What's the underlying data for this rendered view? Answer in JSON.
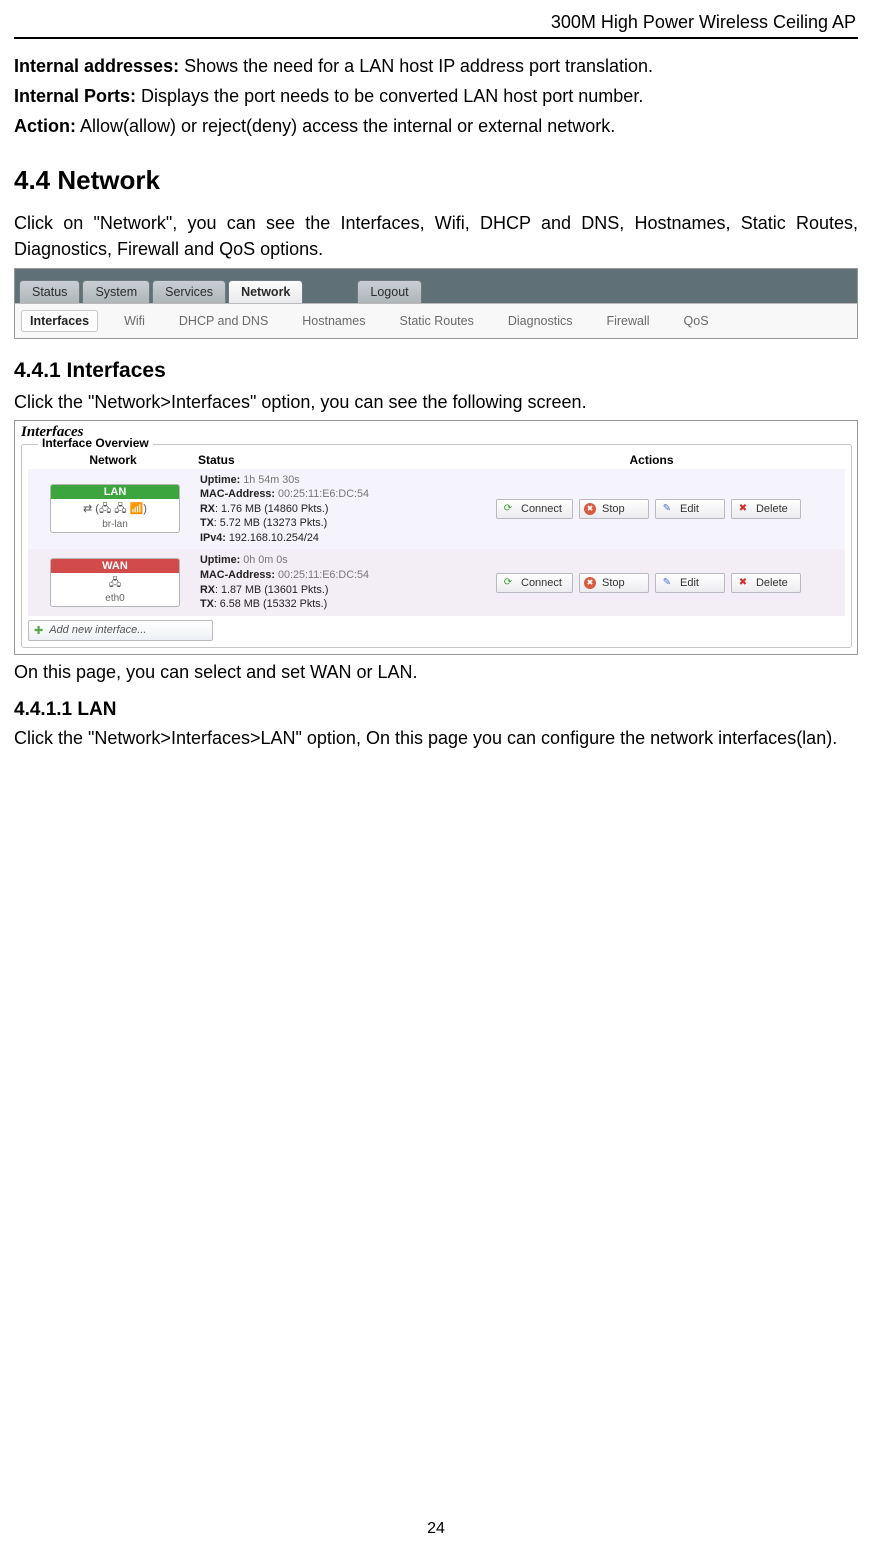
{
  "header": {
    "product": "300M High Power Wireless Ceiling AP"
  },
  "definitions": {
    "internal_addresses_label": "Internal addresses:",
    "internal_addresses_text": " Shows the need for a LAN host IP address port translation.",
    "internal_ports_label": "Internal Ports:",
    "internal_ports_text": " Displays the port needs to be converted LAN host port number.",
    "action_label": "Action:",
    "action_text": " Allow(allow) or reject(deny) access the internal or external network."
  },
  "section": {
    "heading": "4.4 Network",
    "intro": "Click on \"Network\", you can see the Interfaces, Wifi, DHCP and DNS, Hostnames, Static Routes, Diagnostics, Firewall and QoS options."
  },
  "nav_screenshot": {
    "tabs": [
      "Status",
      "System",
      "Services",
      "Network",
      "Logout"
    ],
    "active_tab": "Network",
    "subtabs": [
      "Interfaces",
      "Wifi",
      "DHCP and DNS",
      "Hostnames",
      "Static Routes",
      "Diagnostics",
      "Firewall",
      "QoS"
    ],
    "active_subtab": "Interfaces"
  },
  "subsection": {
    "heading": "4.4.1 Interfaces",
    "intro": "Click the \"Network>Interfaces\" option, you can see the following screen."
  },
  "interfaces_screenshot": {
    "title": "Interfaces",
    "legend": "Interface Overview",
    "columns": {
      "network": "Network",
      "status": "Status",
      "actions": "Actions"
    },
    "rows": [
      {
        "type": "lan",
        "label": "LAN",
        "ifname": "br-lan",
        "iconrow": "⇄ (🖧 🖧 📶)",
        "uptime_label": "Uptime:",
        "uptime": "1h 54m 30s",
        "mac_label": "MAC-Address:",
        "mac": "00:25:11:E6:DC:54",
        "rx_label": "RX",
        "rx": ": 1.76 MB (14860 Pkts.)",
        "tx_label": "TX",
        "tx": ": 5.72 MB (13273 Pkts.)",
        "ipv4_label": "IPv4:",
        "ipv4": "192.168.10.254/24"
      },
      {
        "type": "wan",
        "label": "WAN",
        "ifname": "eth0",
        "iconrow": "🖧",
        "uptime_label": "Uptime:",
        "uptime": "0h 0m 0s",
        "mac_label": "MAC-Address:",
        "mac": "00:25:11:E6:DC:54",
        "rx_label": "RX",
        "rx": ": 1.87 MB (13601 Pkts.)",
        "tx_label": "TX",
        "tx": ": 6.58 MB (15332 Pkts.)"
      }
    ],
    "buttons": {
      "connect": "Connect",
      "stop": "Stop",
      "edit": "Edit",
      "delete": "Delete"
    },
    "add_label": "Add new interface..."
  },
  "after_interfaces": "On this page, you can select and set WAN or LAN.",
  "subsub": {
    "heading": "4.4.1.1 LAN",
    "text": "Click the \"Network>Interfaces>LAN\" option, On this page you can configure the network interfaces(lan)."
  },
  "page_number": "24"
}
